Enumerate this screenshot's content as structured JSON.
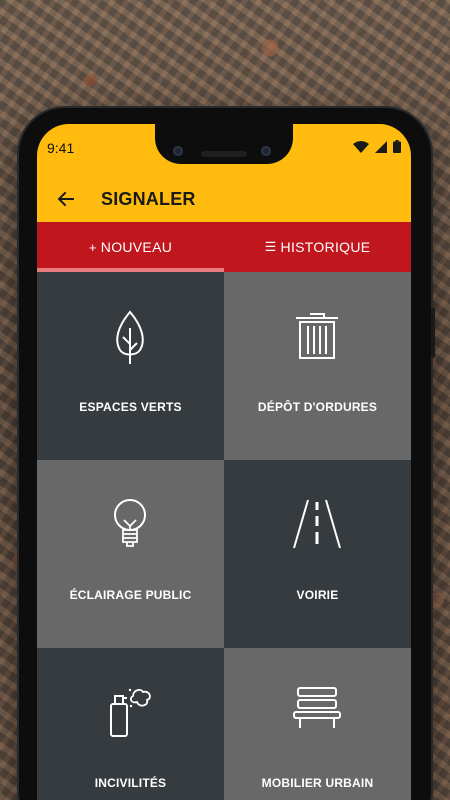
{
  "status_bar": {
    "time": "9:41"
  },
  "app_bar": {
    "title": "SIGNALER"
  },
  "tabs": [
    {
      "glyph": "+",
      "label": "NOUVEAU",
      "active": true
    },
    {
      "glyph": "☰",
      "label": "HISTORIQUE",
      "active": false
    }
  ],
  "categories": [
    {
      "label": "ESPACES VERTS",
      "icon": "leaf-icon"
    },
    {
      "label": "DÉPÔT D'ORDURES",
      "icon": "trash-icon"
    },
    {
      "label": "ÉCLAIRAGE PUBLIC",
      "icon": "lightbulb-icon"
    },
    {
      "label": "VOIRIE",
      "icon": "road-icon"
    },
    {
      "label": "INCIVILITÉS",
      "icon": "spray-can-icon"
    },
    {
      "label": "MOBILIER URBAIN",
      "icon": "bench-icon"
    }
  ],
  "colors": {
    "appbar": "#ffbc0f",
    "tabs": "#c0161e",
    "tab_indicator": "#e87a80",
    "tile_dark": "#353b3e",
    "tile_light": "#686868"
  }
}
